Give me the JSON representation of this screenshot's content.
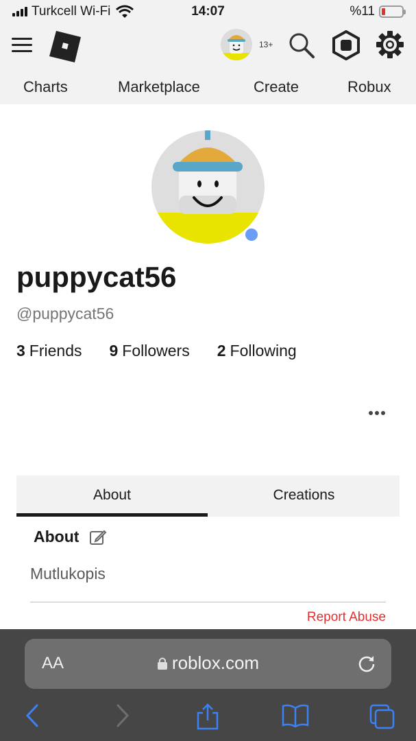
{
  "status_bar": {
    "carrier": "Turkcell Wi-Fi",
    "time": "14:07",
    "battery": "%11",
    "battery_level": 0.11
  },
  "header": {
    "age_badge": "13+"
  },
  "nav": {
    "items": [
      "Charts",
      "Marketplace",
      "Create",
      "Robux"
    ]
  },
  "profile": {
    "display_name": "puppycat56",
    "username": "@puppycat56",
    "friends_count": "3",
    "friends_label": "Friends",
    "followers_count": "9",
    "followers_label": "Followers",
    "following_count": "2",
    "following_label": "Following",
    "online_status_color": "#6a9ef5"
  },
  "tabs": {
    "about": "About",
    "creations": "Creations"
  },
  "about": {
    "heading": "About",
    "text": "Mutlukopis",
    "report": "Report Abuse"
  },
  "browser": {
    "text_size": "AA",
    "domain": "roblox.com"
  },
  "colors": {
    "report": "#e03030",
    "browser_accent": "#3b82f6"
  }
}
